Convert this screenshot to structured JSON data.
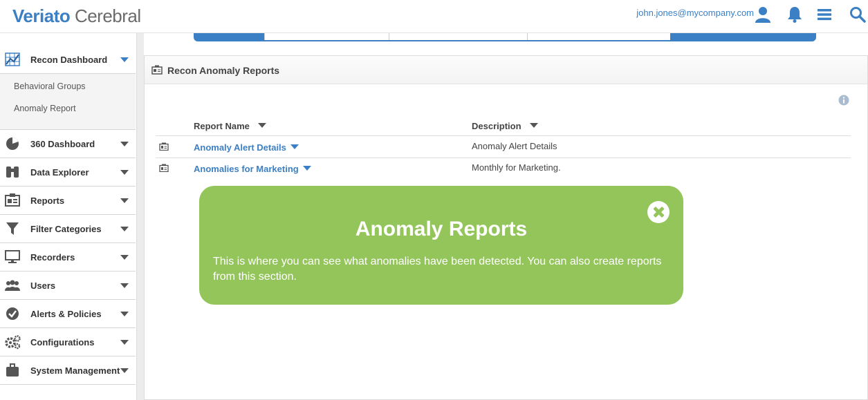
{
  "header": {
    "logo_brand": "Veriato",
    "logo_product": " Cerebral",
    "user_email": "john.jones@mycompany.com"
  },
  "sidebar": {
    "active_item": {
      "label": "Recon Dashboard",
      "icon": "bar-chart-icon"
    },
    "subitems": [
      "Behavioral Groups",
      "Anomaly Report"
    ],
    "items": [
      {
        "label": "360 Dashboard",
        "icon": "pie-chart-icon"
      },
      {
        "label": "Data Explorer",
        "icon": "binoculars-icon"
      },
      {
        "label": "Reports",
        "icon": "report-card-icon"
      },
      {
        "label": "Filter Categories",
        "icon": "funnel-icon"
      },
      {
        "label": "Recorders",
        "icon": "monitor-icon"
      },
      {
        "label": "Users",
        "icon": "users-icon"
      },
      {
        "label": "Alerts & Policies",
        "icon": "check-circle-icon"
      },
      {
        "label": "Configurations",
        "icon": "gears-icon"
      },
      {
        "label": "System Management",
        "icon": "briefcase-icon"
      }
    ]
  },
  "panel": {
    "title": "Recon Anomaly Reports",
    "columns": [
      "Report Name",
      "Description"
    ],
    "rows": [
      {
        "name": "Anomaly Alert Details",
        "description": "Anomaly Alert Details"
      },
      {
        "name": "Anomalies for Marketing",
        "description": "Monthly for Marketing."
      }
    ]
  },
  "callout": {
    "title": "Anomaly Reports",
    "body": "This is where you can see what anomalies have been detected.  You can also create reports from this section."
  },
  "colors": {
    "brand_blue": "#3b7fc4",
    "callout_green": "#94c55a"
  }
}
